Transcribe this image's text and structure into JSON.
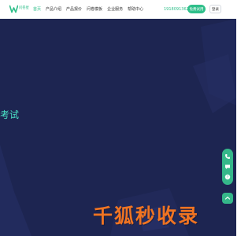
{
  "header": {
    "logo_text": "问卷星",
    "logo_icon": "w-logo-icon",
    "nav": [
      {
        "label": "首页",
        "active": true
      },
      {
        "label": "产品介绍",
        "active": false
      },
      {
        "label": "产品报价",
        "active": false
      },
      {
        "label": "问卷模板",
        "active": false
      },
      {
        "label": "企业服务",
        "active": false
      },
      {
        "label": "帮助中心",
        "active": false
      }
    ],
    "phone": "19180913626",
    "trial_label": "免费试用",
    "login_label": "登录"
  },
  "hero": {
    "headline": "考试",
    "background_color": "#1d2551",
    "accent_color": "#4ae0c4"
  },
  "float_bar": {
    "icons": [
      "phone-icon",
      "chat-icon",
      "help-icon"
    ],
    "top_icon": "back-to-top-icon",
    "color": "#35b78a"
  },
  "watermark": {
    "text": "千狐秒收录",
    "color": "#f07422"
  }
}
